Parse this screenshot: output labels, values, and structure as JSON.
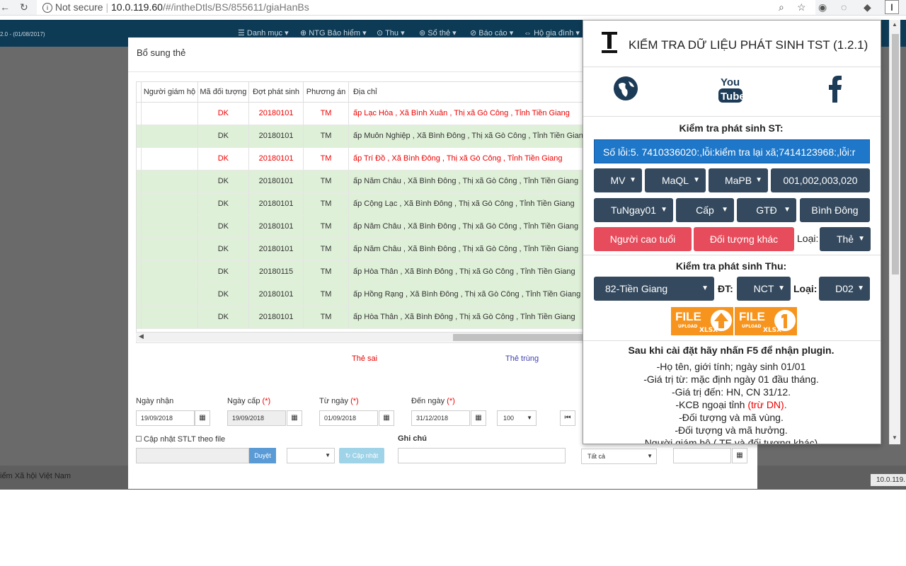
{
  "browser": {
    "back": "←",
    "reload": "↻",
    "not_secure": "Not secure",
    "url_host": "10.0.119.60",
    "url_path": "/#/intheDtls/BS/855611/giaHanBs"
  },
  "app": {
    "version": "2.0 - (01/08/2017)",
    "menu": [
      "Danh mục",
      "NTG Bảo hiểm",
      "Thu",
      "Sổ thẻ",
      "Báo cáo",
      "Hộ gia đình"
    ],
    "footer_text": "iểm Xã hội Việt Nam",
    "footer_ip": "10.0.119."
  },
  "modal": {
    "title": "Bổ sung thẻ",
    "columns": [
      "Người giám hộ",
      "Mã đối tượng",
      "Đợt phát sinh",
      "Phương án",
      "Địa chỉ"
    ],
    "rows": [
      {
        "status": "red",
        "guardian": "",
        "code": "DK",
        "batch": "20180101",
        "plan": "TM",
        "address": "ấp Lạc Hòa , Xã Bình Xuân , Thị xã Gò Công , Tỉnh Tiền Giang"
      },
      {
        "status": "green",
        "guardian": "",
        "code": "DK",
        "batch": "20180101",
        "plan": "TM",
        "address": "ấp Muôn Nghiệp , Xã Bình Đông , Thị xã Gò Công , Tỉnh Tiền Giang"
      },
      {
        "status": "red",
        "guardian": "",
        "code": "DK",
        "batch": "20180101",
        "plan": "TM",
        "address": "ấp Trí Đồ , Xã Bình Đông , Thị xã Gò Công , Tỉnh Tiền Giang"
      },
      {
        "status": "green",
        "guardian": "",
        "code": "DK",
        "batch": "20180101",
        "plan": "TM",
        "address": "ấp Năm Châu , Xã Bình Đông , Thị xã Gò Công , Tỉnh Tiền Giang"
      },
      {
        "status": "green",
        "guardian": "",
        "code": "DK",
        "batch": "20180101",
        "plan": "TM",
        "address": "ấp Cộng Lạc , Xã Bình Đông , Thị xã Gò Công , Tỉnh Tiền Giang"
      },
      {
        "status": "green",
        "guardian": "",
        "code": "DK",
        "batch": "20180101",
        "plan": "TM",
        "address": "ấp Năm Châu , Xã Bình Đông , Thị xã Gò Công , Tỉnh Tiền Giang"
      },
      {
        "status": "green",
        "guardian": "",
        "code": "DK",
        "batch": "20180101",
        "plan": "TM",
        "address": "ấp Năm Châu , Xã Bình Đông , Thị xã Gò Công , Tỉnh Tiền Giang"
      },
      {
        "status": "green",
        "guardian": "",
        "code": "DK",
        "batch": "20180115",
        "plan": "TM",
        "address": "ấp Hòa Thân , Xã Bình Đông , Thị xã Gò Công , Tỉnh Tiền Giang"
      },
      {
        "status": "green",
        "guardian": "",
        "code": "DK",
        "batch": "20180101",
        "plan": "TM",
        "address": "ấp Hồng Rạng , Xã Bình Đông , Thị xã Gò Công , Tỉnh Tiền Giang"
      },
      {
        "status": "green",
        "guardian": "",
        "code": "DK",
        "batch": "20180101",
        "plan": "TM",
        "address": "ấp Hòa Thân , Xã Bình Đông , Thị xã Gò Công , Tỉnh Tiền Giang"
      }
    ],
    "legend": {
      "wrong": "Thẻ sai",
      "duplicate": "Thẻ trùng"
    },
    "form": {
      "ngay_nhan_label": "Ngày nhận",
      "ngay_nhan": "19/09/2018",
      "ngay_cap_label": "Ngày cấp",
      "ngay_cap": "19/09/2018",
      "tu_ngay_label": "Từ ngày",
      "tu_ngay": "01/09/2018",
      "den_ngay_label": "Đến ngày",
      "den_ngay": "31/12/2018",
      "page_size": "100",
      "required_mark": "(*)",
      "cap_nhat_label": "Cập nhật STLT theo file",
      "browse_button": "Duyệt",
      "update_button": "Cập nhật",
      "ghi_chu_label": "Ghi chú",
      "filter_all": "Tất cả"
    }
  },
  "plugin": {
    "title": "KIỂM TRA DỮ LIỆU PHÁT SINH TST (1.2.1)",
    "section1_title": "Kiểm tra phát sinh ST:",
    "error_text": "Số lỗi:5. 7410336020:,lỗi:kiểm tra lại xã;7414123968:,lỗi:r",
    "row1": [
      "MV",
      "MaQL",
      "MaPB",
      "001,002,003,020"
    ],
    "row2": [
      "TuNgay01",
      "Cấp",
      "GTĐ",
      "Bình Đông"
    ],
    "btn_elderly": "Người cao tuổi",
    "btn_other": "Đối tượng khác",
    "type_label": "Loại:",
    "type_value": "Thẻ",
    "section2_title": "Kiểm tra phát sinh Thu:",
    "province": "82-Tiền Giang",
    "dt_label": "ĐT:",
    "dt_value": "NCT",
    "type2_label": "Loại:",
    "type2_value": "D02",
    "upload_file": "FILE",
    "upload_word": "UPLOAD",
    "upload_ext": "XLSX",
    "info_title": "Sau khi cài đặt hãy nhấn F5 để nhận plugin.",
    "info_lines": [
      "-Họ tên, giới tính; ngày sinh 01/01",
      "-Giá trị từ: mặc định ngày 01 đầu tháng.",
      "-Giá trị đến: HN, CN 31/12.",
      "-KCB ngoại tỉnh",
      "-Đối tượng và mã vùng.",
      "-Đối tượng và mã hưởng.",
      "Người giám hộ ( TE và đối tượng khác)"
    ],
    "info_red": "(trừ DN).",
    "accent_red": "#e74c5c",
    "accent_dark": "#34495e",
    "accent_blue": "#1e77c8"
  }
}
